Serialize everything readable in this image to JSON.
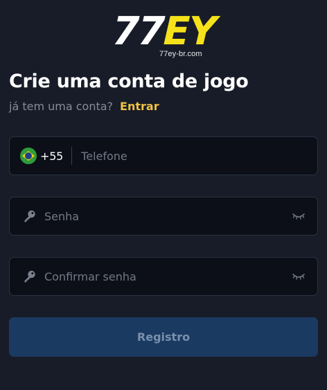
{
  "logo": {
    "number": "77",
    "letters": "EY",
    "domain": "77ey-br.com"
  },
  "page": {
    "title": "Crie uma conta de jogo",
    "subtitle": "já tem uma conta?",
    "login_link": "Entrar"
  },
  "phone": {
    "country_icon": "brazil-flag-icon",
    "dial_code": "+55",
    "placeholder": "Telefone",
    "value": ""
  },
  "password": {
    "icon": "key-icon",
    "placeholder": "Senha",
    "value": "",
    "visibility_icon": "eye-closed-icon"
  },
  "confirm_password": {
    "icon": "key-icon",
    "placeholder": "Confirmar senha",
    "value": "",
    "visibility_icon": "eye-closed-icon"
  },
  "submit": {
    "label": "Registro"
  },
  "colors": {
    "background": "#181c28",
    "field_background": "#0c0f17",
    "accent_yellow": "#f6e21a",
    "link": "#f0c242",
    "button": "#1b3a61",
    "button_text": "#7890ad"
  }
}
